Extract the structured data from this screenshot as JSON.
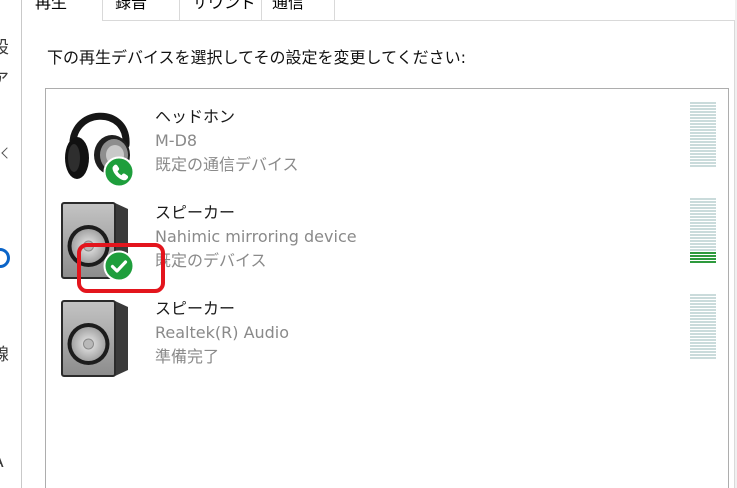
{
  "tabs": [
    {
      "label": "再生",
      "selected": true
    },
    {
      "label": "録音",
      "selected": false
    },
    {
      "label": "サウンド",
      "selected": false
    },
    {
      "label": "通信",
      "selected": false
    }
  ],
  "instruction": "下の再生デバイスを選択してその設定を変更してください:",
  "devices": [
    {
      "name": "ヘッドホン",
      "description": "M-D8",
      "status": "既定の通信デバイス",
      "icon": "headphones-icon",
      "badge": "phone-badge-icon",
      "level": 0
    },
    {
      "name": "スピーカー",
      "description": "Nahimic mirroring device",
      "status": "既定のデバイス",
      "icon": "speaker-icon",
      "badge": "check-badge-icon",
      "level": 0.18
    },
    {
      "name": "スピーカー",
      "description": "Realtek(R) Audio",
      "status": "準備完了",
      "icon": "speaker-icon",
      "badge": null,
      "level": 0
    }
  ],
  "background_window": {
    "fragments": [
      "設",
      "ア",
      "線",
      "A"
    ]
  },
  "colors": {
    "badge_green": "#1e9e3c",
    "meter_idle": "#cadbdb",
    "meter_active": "#2e9a3e",
    "highlight_red": "#e3151d",
    "secondary_text": "#8a8a8a"
  }
}
